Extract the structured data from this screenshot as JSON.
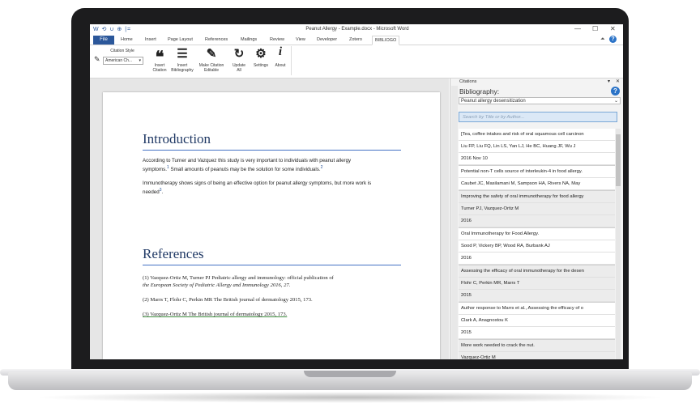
{
  "window": {
    "title": "Peanut Allergy - Example.docx - Microsoft Word",
    "quick_access": "W  ⟲ ∪ ⊕ |=",
    "controls": [
      "—",
      "☐",
      "✕"
    ]
  },
  "ribbon_tabs": [
    "File",
    "Home",
    "Insert",
    "Page Layout",
    "References",
    "Mailings",
    "Review",
    "View",
    "Developer",
    "Zotero",
    "BIBLIOGO"
  ],
  "ribbon": {
    "citation_style_label": "Citation Style",
    "citation_style_value": "American Ch...",
    "buttons": [
      {
        "label": "Insert\nCitation",
        "icon": "quote-icon"
      },
      {
        "label": "Insert\nBibliography",
        "icon": "list-icon"
      },
      {
        "label": "Make Citation\nEditable",
        "icon": "pen-icon"
      },
      {
        "label": "Update\nAll",
        "icon": "refresh-icon"
      },
      {
        "label": "Settings",
        "icon": "gear-icon"
      },
      {
        "label": "About",
        "icon": "info-icon"
      }
    ]
  },
  "document": {
    "intro_heading": "Introduction",
    "para1": "According to Turner and Vazquez this study is very important to individuals with peanut allergy",
    "para1b": "symptoms.",
    "para1_sup1": "1",
    "para1c": " Small amounts of peanuts may be the solution for some individuals.",
    "para1_sup2": "2",
    "para2": "Immunotherapy shows signs of being an effective option for peanut allergy symptoms, but more work is",
    "para2b": "needed",
    "para2_sup": "3",
    "para2c": ".",
    "refs_heading": "References",
    "ref1": "(1)    Vazquez-Ortiz M, Turner PJ Pediatric allergy and immunology: official publication of",
    "ref1b": "the European Society of Pediatric Allergy and Immunology 2016, 27.",
    "ref2": "(2)    Marrs T, Flohr C, Perkin MR The British journal of dermatology 2015, 173.",
    "ref3": "(3)    Vazquez-Ortiz M The British journal of dermatology 2015, 173."
  },
  "pane": {
    "title": "Citations",
    "bibliography_label": "Bibliography:",
    "bibliography_value": "Peanut allergy desensitization",
    "search_placeholder": "Search by Title or by Author...",
    "items": [
      {
        "title": "[Tea, coffee intakes and risk of oral squamous cell carcinon",
        "authors": "Liu FP, Liu FQ, Lin LS, Yan LJ, He BC, Huang JF, Wu J",
        "year": "2016 Nov 10",
        "alt": false
      },
      {
        "title": "Potential non-T cells source of interleukin-4 in food allergy.",
        "authors": "Caubet JC, Masilamani M, Sampson HA, Rivers NA, May",
        "year": "",
        "alt": false
      },
      {
        "title": "Improving the safety of oral immunotherapy for food allergy",
        "authors": "Turner PJ, Vazquez-Ortiz M",
        "year": "2016",
        "alt": true
      },
      {
        "title": "Oral Immunotherapy for Food Allergy.",
        "authors": "Sood P, Vickery BP, Wood RA, Burbank AJ",
        "year": "2016",
        "alt": false
      },
      {
        "title": "Assessing the efficacy of oral immunotherapy for the desen",
        "authors": "Flohr C, Perkin MR, Marrs T",
        "year": "2015",
        "alt": true
      },
      {
        "title": "Author response to Marrs et al., Assessing the efficacy of o",
        "authors": "Clark A, Anagnostou K",
        "year": "2015",
        "alt": false
      },
      {
        "title": "More work needed to crack the nut.",
        "authors": "Vazquez-Ortiz M",
        "year": "",
        "alt": true
      }
    ]
  },
  "colors": {
    "accent": "#2b579a",
    "heading": "#1f3864",
    "rule": "#4472c4"
  }
}
